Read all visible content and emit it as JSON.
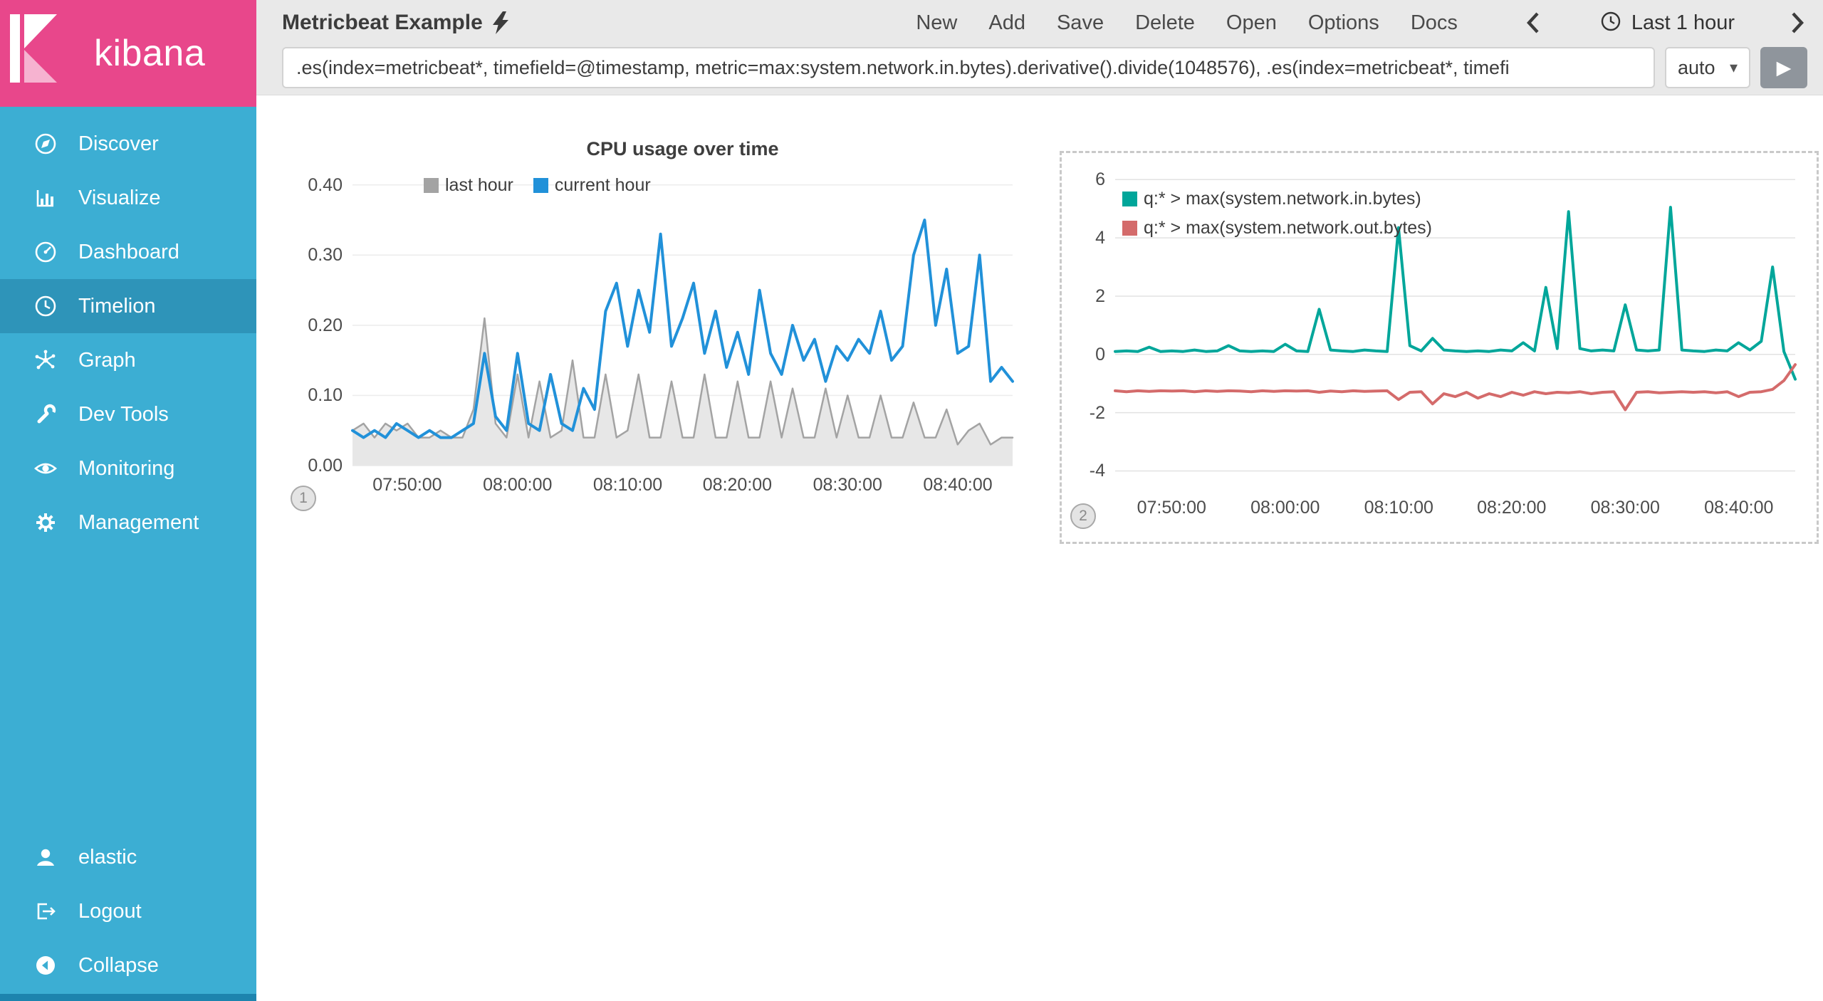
{
  "theme": {
    "sidebar_color": "#3caed3",
    "sidebar_selected_color": "#2e94b9",
    "brand_pink": "#e8478b",
    "header_gray": "#e9e9e9",
    "blue_series": "#2191d9",
    "gray_series": "#a3a3a3",
    "teal_series": "#00a69a",
    "red_series": "#d46b6b"
  },
  "icons": {
    "caret_down": "▾",
    "play": "▶"
  },
  "sidebar": {
    "brand": "kibana",
    "items": [
      {
        "label": "Discover",
        "icon": "compass-icon"
      },
      {
        "label": "Visualize",
        "icon": "bar-chart-icon"
      },
      {
        "label": "Dashboard",
        "icon": "gauge-icon"
      },
      {
        "label": "Timelion",
        "icon": "clock-icon",
        "selected": true
      },
      {
        "label": "Graph",
        "icon": "graph-icon"
      },
      {
        "label": "Dev Tools",
        "icon": "wrench-icon"
      },
      {
        "label": "Monitoring",
        "icon": "eye-icon"
      },
      {
        "label": "Management",
        "icon": "gear-icon"
      }
    ],
    "bottom_items": [
      {
        "label": "elastic",
        "icon": "user-icon"
      },
      {
        "label": "Logout",
        "icon": "logout-icon"
      },
      {
        "label": "Collapse",
        "icon": "collapse-icon"
      }
    ]
  },
  "header": {
    "title": "Metricbeat Example",
    "nav": [
      "New",
      "Add",
      "Save",
      "Delete",
      "Open",
      "Options",
      "Docs"
    ],
    "time_label": "Last 1 hour"
  },
  "query_bar": {
    "value": ".es(index=metricbeat*, timefield=@timestamp, metric=max:system.network.in.bytes).derivative().divide(1048576), .es(index=metricbeat*, timefi",
    "interval": "auto"
  },
  "panels": [
    {
      "badge": "1"
    },
    {
      "badge": "2"
    }
  ],
  "chart_data": [
    {
      "type": "line",
      "title": "CPU usage over time",
      "ylim": [
        0,
        0.42
      ],
      "baseline": 0,
      "grid_color": "#ececec",
      "y_ticks": [
        [
          0,
          "0.00"
        ],
        [
          0.1,
          "0.10"
        ],
        [
          0.2,
          "0.20"
        ],
        [
          0.3,
          "0.30"
        ],
        [
          0.4,
          "0.40"
        ]
      ],
      "x_ticks": [
        [
          0.083,
          "07:50:00"
        ],
        [
          0.25,
          "08:00:00"
        ],
        [
          0.417,
          "08:10:00"
        ],
        [
          0.583,
          "08:20:00"
        ],
        [
          0.75,
          "08:30:00"
        ],
        [
          0.917,
          "08:40:00"
        ]
      ],
      "x_range": "07:45:00 - 08:45:00, one point per minute",
      "legend_position": "top-left",
      "series": [
        {
          "name": "last hour",
          "color": "#a3a3a3",
          "fill": "#e7e7e7",
          "width": 2.5,
          "values": [
            0.05,
            0.06,
            0.04,
            0.06,
            0.05,
            0.06,
            0.04,
            0.04,
            0.05,
            0.04,
            0.04,
            0.08,
            0.21,
            0.06,
            0.04,
            0.13,
            0.04,
            0.12,
            0.04,
            0.05,
            0.15,
            0.04,
            0.04,
            0.13,
            0.04,
            0.05,
            0.13,
            0.04,
            0.04,
            0.12,
            0.04,
            0.04,
            0.13,
            0.04,
            0.04,
            0.12,
            0.04,
            0.04,
            0.12,
            0.04,
            0.11,
            0.04,
            0.04,
            0.11,
            0.04,
            0.1,
            0.04,
            0.04,
            0.1,
            0.04,
            0.04,
            0.09,
            0.04,
            0.04,
            0.08,
            0.03,
            0.05,
            0.06,
            0.03,
            0.04,
            0.04
          ]
        },
        {
          "name": "current hour",
          "color": "#2191d9",
          "width": 4,
          "values": [
            0.05,
            0.04,
            0.05,
            0.04,
            0.06,
            0.05,
            0.04,
            0.05,
            0.04,
            0.04,
            0.05,
            0.06,
            0.16,
            0.07,
            0.05,
            0.16,
            0.06,
            0.05,
            0.13,
            0.06,
            0.05,
            0.11,
            0.08,
            0.22,
            0.26,
            0.17,
            0.25,
            0.19,
            0.33,
            0.17,
            0.21,
            0.26,
            0.16,
            0.22,
            0.14,
            0.19,
            0.13,
            0.25,
            0.16,
            0.13,
            0.2,
            0.15,
            0.18,
            0.12,
            0.17,
            0.15,
            0.18,
            0.16,
            0.22,
            0.15,
            0.17,
            0.3,
            0.35,
            0.2,
            0.28,
            0.16,
            0.17,
            0.3,
            0.12,
            0.14,
            0.12
          ]
        }
      ]
    },
    {
      "type": "line",
      "title": "",
      "ylim": [
        -4.6,
        6.3
      ],
      "grid_color": "#e2e2e2",
      "y_ticks": [
        [
          -4,
          "-4"
        ],
        [
          -2,
          "-2"
        ],
        [
          0,
          "0"
        ],
        [
          2,
          "2"
        ],
        [
          4,
          "4"
        ],
        [
          6,
          "6"
        ]
      ],
      "x_ticks": [
        [
          0.083,
          "07:50:00"
        ],
        [
          0.25,
          "08:00:00"
        ],
        [
          0.417,
          "08:10:00"
        ],
        [
          0.583,
          "08:20:00"
        ],
        [
          0.75,
          "08:30:00"
        ],
        [
          0.917,
          "08:40:00"
        ]
      ],
      "x_range": "07:45:00 - 08:45:00, one point per minute",
      "legend_position": "top-left",
      "series": [
        {
          "name": "q:* > max(system.network.in.bytes)",
          "color": "#00a69a",
          "width": 4,
          "values": [
            0.1,
            0.12,
            0.1,
            0.25,
            0.1,
            0.12,
            0.1,
            0.15,
            0.1,
            0.12,
            0.3,
            0.12,
            0.1,
            0.12,
            0.1,
            0.35,
            0.12,
            0.1,
            1.55,
            0.15,
            0.12,
            0.1,
            0.15,
            0.12,
            0.1,
            4.35,
            0.3,
            0.12,
            0.55,
            0.15,
            0.12,
            0.1,
            0.12,
            0.1,
            0.15,
            0.12,
            0.4,
            0.12,
            2.3,
            0.2,
            4.9,
            0.2,
            0.12,
            0.15,
            0.12,
            1.7,
            0.15,
            0.12,
            0.15,
            5.05,
            0.15,
            0.12,
            0.1,
            0.15,
            0.12,
            0.4,
            0.15,
            0.45,
            3.0,
            0.1,
            -0.85
          ]
        },
        {
          "name": "q:* > max(system.network.out.bytes)",
          "color": "#d46b6b",
          "width": 4,
          "values": [
            -1.25,
            -1.28,
            -1.25,
            -1.27,
            -1.25,
            -1.26,
            -1.25,
            -1.28,
            -1.25,
            -1.27,
            -1.25,
            -1.26,
            -1.28,
            -1.25,
            -1.27,
            -1.25,
            -1.26,
            -1.25,
            -1.3,
            -1.26,
            -1.28,
            -1.25,
            -1.27,
            -1.26,
            -1.25,
            -1.55,
            -1.3,
            -1.28,
            -1.7,
            -1.35,
            -1.45,
            -1.3,
            -1.5,
            -1.35,
            -1.45,
            -1.3,
            -1.4,
            -1.28,
            -1.35,
            -1.3,
            -1.32,
            -1.28,
            -1.35,
            -1.3,
            -1.28,
            -1.9,
            -1.3,
            -1.28,
            -1.32,
            -1.3,
            -1.28,
            -1.3,
            -1.28,
            -1.32,
            -1.28,
            -1.45,
            -1.3,
            -1.28,
            -1.2,
            -0.9,
            -0.35
          ]
        }
      ]
    }
  ]
}
